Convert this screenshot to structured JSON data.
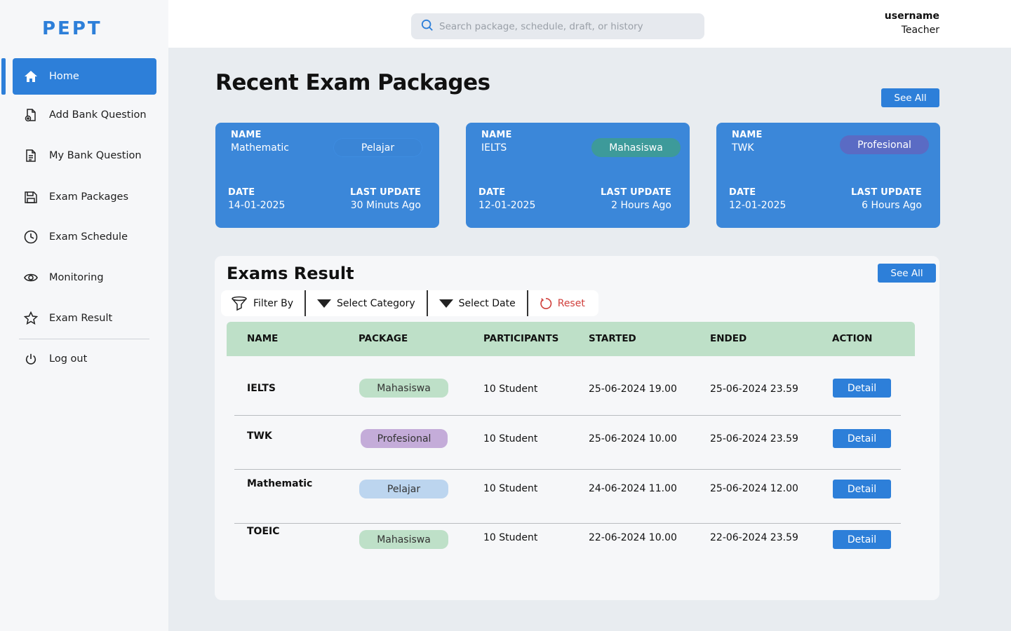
{
  "app": {
    "logo": "PEPT"
  },
  "colors": {
    "primary": "#2d7fd9",
    "mahasiswa": "#bee0c8",
    "profesional": "#c4acd9",
    "pelajar": "#bcd5ef",
    "reset": "#d0403c"
  },
  "sidebar": {
    "items": [
      {
        "label": "Home",
        "icon": "home-icon",
        "active": true
      },
      {
        "label": "Add Bank Question",
        "icon": "file-add-icon"
      },
      {
        "label": "My Bank Question",
        "icon": "document-icon"
      },
      {
        "label": "Exam Packages",
        "icon": "save-icon"
      },
      {
        "label": "Exam Schedule",
        "icon": "clock-icon"
      },
      {
        "label": "Monitoring",
        "icon": "eye-icon"
      },
      {
        "label": "Exam Result",
        "icon": "star-icon"
      }
    ],
    "logout": {
      "label": "Log out",
      "icon": "power-icon"
    }
  },
  "header": {
    "search": {
      "placeholder": "Search package, schedule, draft, or history",
      "icon": "search-icon"
    },
    "user": {
      "name": "username",
      "role": "Teacher"
    }
  },
  "recent": {
    "title": "Recent Exam Packages",
    "see_all": "See All",
    "cards": [
      {
        "name_label": "NAME",
        "name": "Mathematic",
        "badge": "Pelajar",
        "date_label": "DATE",
        "date": "14-01-2025",
        "update_label": "LAST UPDATE",
        "update": "30 Minuts Ago"
      },
      {
        "name_label": "NAME",
        "name": "IELTS",
        "badge": "Mahasiswa",
        "date_label": "DATE",
        "date": "12-01-2025",
        "update_label": "LAST UPDATE",
        "update": "2 Hours Ago"
      },
      {
        "name_label": "NAME",
        "name": "TWK",
        "badge": "Profesional",
        "date_label": "DATE",
        "date": "12-01-2025",
        "update_label": "LAST UPDATE",
        "update": "6 Hours Ago"
      }
    ]
  },
  "results": {
    "title": "Exams Result",
    "see_all": "See All",
    "filters": {
      "filter_by": "Filter By",
      "category": "Select Category",
      "date": "Select Date",
      "reset": "Reset"
    },
    "columns": [
      "NAME",
      "PACKAGE",
      "PARTICIPANTS",
      "STARTED",
      "ENDED",
      "ACTION"
    ],
    "rows": [
      {
        "name": "IELTS",
        "package": "Mahasiswa",
        "participants": "10 Student",
        "started": "25-06-2024 19.00",
        "ended": "25-06-2024 23.59",
        "action": "Detail"
      },
      {
        "name": "TWK",
        "package": "Profesional",
        "participants": "10 Student",
        "started": "25-06-2024 10.00",
        "ended": "25-06-2024 23.59",
        "action": "Detail"
      },
      {
        "name": "Mathematic",
        "package": "Pelajar",
        "participants": "10 Student",
        "started": "24-06-2024 11.00",
        "ended": "25-06-2024 12.00",
        "action": "Detail"
      },
      {
        "name": "TOEIC",
        "package": "Mahasiswa",
        "participants": "10 Student",
        "started": "22-06-2024 10.00",
        "ended": "22-06-2024 23.59",
        "action": "Detail"
      }
    ]
  }
}
